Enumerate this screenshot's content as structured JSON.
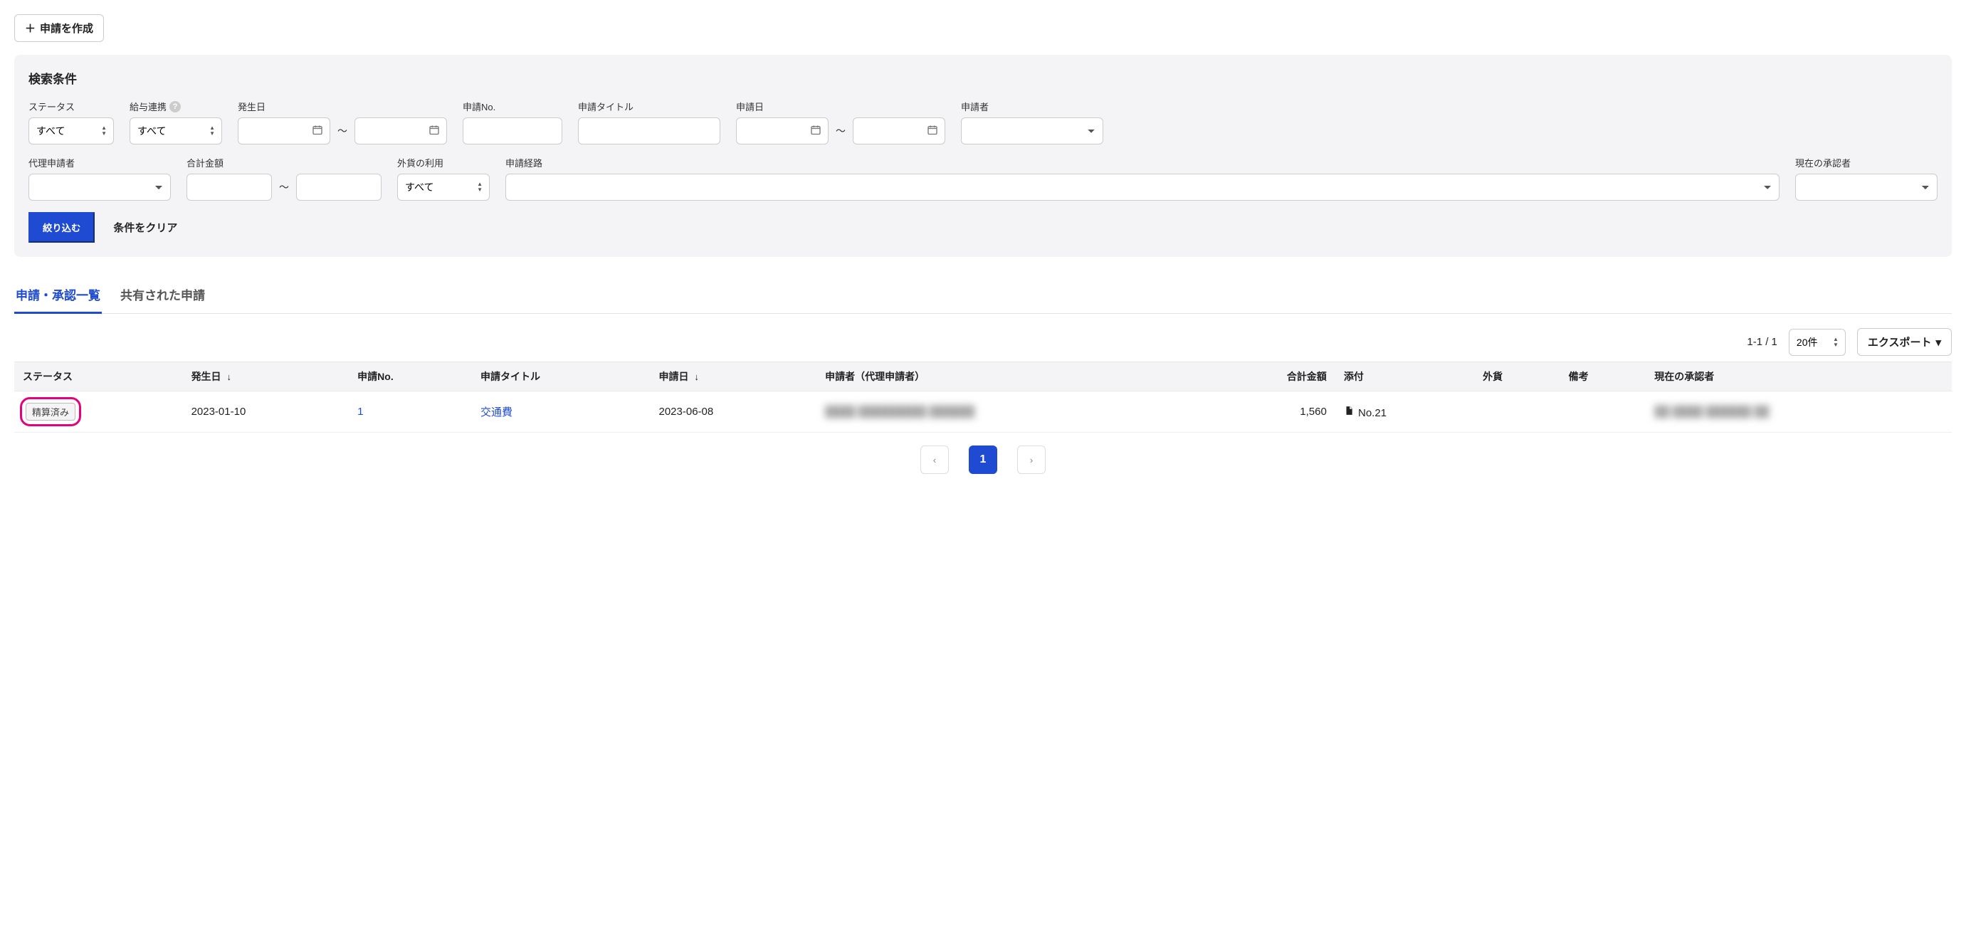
{
  "toolbar": {
    "create_label": "申請を作成"
  },
  "search": {
    "title": "検索条件",
    "labels": {
      "status": "ステータス",
      "payroll": "給与連携",
      "occur_date": "発生日",
      "request_no": "申請No.",
      "request_title": "申請タイトル",
      "request_date": "申請日",
      "applicant": "申請者",
      "proxy_applicant": "代理申請者",
      "total_amount": "合計金額",
      "foreign_currency": "外貨の利用",
      "route": "申請経路",
      "current_approver": "現在の承認者"
    },
    "values": {
      "status_option": "すべて",
      "payroll_option": "すべて",
      "foreign_option": "すべて",
      "range_sep": "〜"
    },
    "actions": {
      "filter": "絞り込む",
      "clear": "条件をクリア"
    }
  },
  "tabs": {
    "list": "申請・承認一覧",
    "shared": "共有された申請"
  },
  "list": {
    "count": "1-1 / 1",
    "page_size": "20件",
    "export": "エクスポート",
    "columns": {
      "status": "ステータス",
      "occur_date": "発生日",
      "request_no": "申請No.",
      "title": "申請タイトル",
      "request_date": "申請日",
      "applicant": "申請者（代理申請者）",
      "total": "合計金額",
      "attach": "添付",
      "fx": "外貨",
      "remarks": "備考",
      "approver": "現在の承認者"
    },
    "row": {
      "status": "精算済み",
      "occur_date": "2023-01-10",
      "request_no": "1",
      "title": "交通費",
      "request_date": "2023-06-08",
      "applicant_masked": "████ █████████ ██████",
      "total": "1,560",
      "attach": "No.21",
      "fx": "",
      "remarks": "",
      "approver_masked": "██ ████ ██████ ██"
    },
    "page_current": "1"
  }
}
